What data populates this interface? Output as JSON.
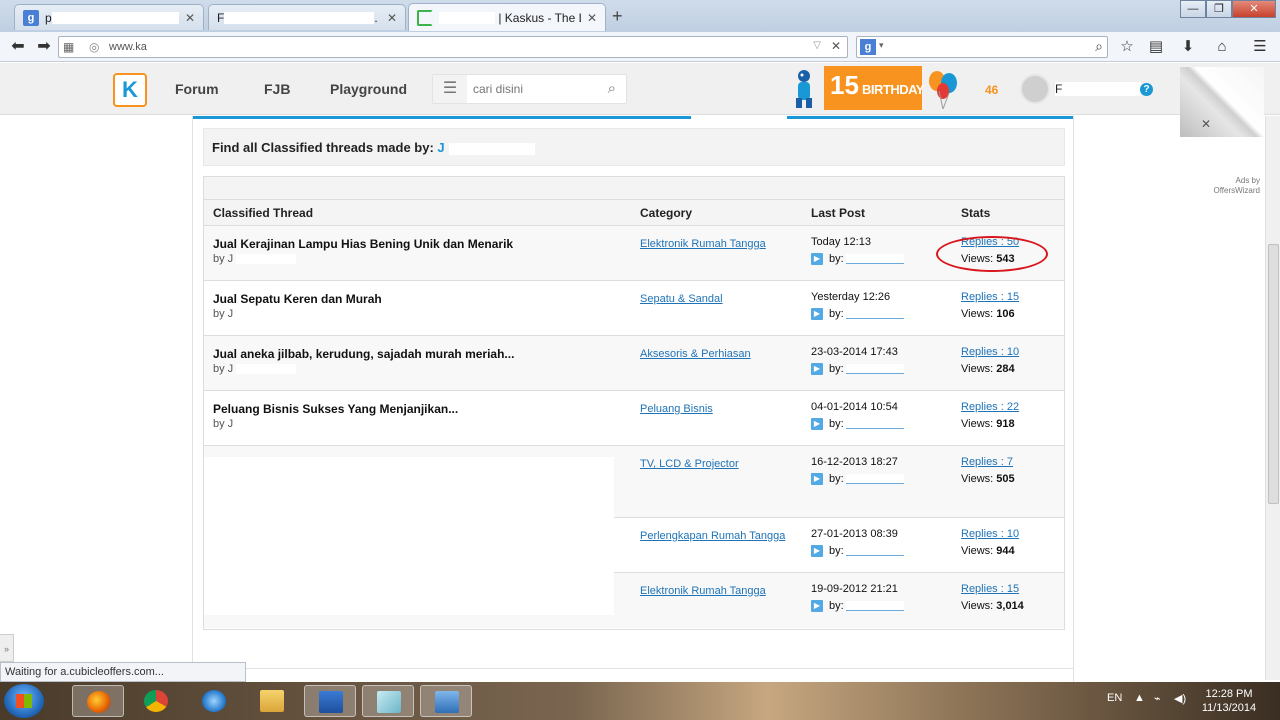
{
  "browser": {
    "tabs": [
      {
        "prefix": "p",
        "suffix": ".",
        "active": false
      },
      {
        "prefix": "F",
        "suffix": ".",
        "active": false
      },
      {
        "prefix": "",
        "suffix": "| Kaskus - The Lar...",
        "active": true
      }
    ],
    "url": "www.ka",
    "window_controls": {
      "minimize": "—",
      "maximize": "❐",
      "close": "✕"
    }
  },
  "kaskus_header": {
    "logo": "K",
    "nav": [
      "Forum",
      "FJB",
      "Playground"
    ],
    "search_placeholder": "cari disini",
    "birthday_number": "15",
    "birthday_text": "BIRTHDAY",
    "notification_count": "46",
    "username": "F",
    "help": "?"
  },
  "ads_label": "Ads by\nOffersWizard",
  "page": {
    "find_title": "Find all Classified threads made by:",
    "find_name": "J",
    "columns": [
      "Classified Thread",
      "Category",
      "Last Post",
      "Stats"
    ],
    "rows": [
      {
        "title": "Jual Kerajinan Lampu Hias Bening Unik dan Menarik",
        "by": "by J",
        "category": "Elektronik Rumah Tangga",
        "last_post": "Today 12:13",
        "last_by": "by:",
        "replies": "Replies : 50",
        "views_label": "Views:",
        "views": "543"
      },
      {
        "title": "Jual Sepatu Keren dan Murah",
        "by": "by J",
        "category": "Sepatu & Sandal",
        "last_post": "Yesterday 12:26",
        "last_by": "by:",
        "replies": "Replies : 15",
        "views_label": "Views:",
        "views": "106"
      },
      {
        "title": "Jual aneka jilbab, kerudung, sajadah murah meriah...",
        "by": "by J",
        "category": "Aksesoris & Perhiasan",
        "last_post": "23-03-2014 17:43",
        "last_by": "by:",
        "replies": "Replies : 10",
        "views_label": "Views:",
        "views": "284"
      },
      {
        "title": "Peluang Bisnis Sukses Yang Menjanjikan...",
        "by": "by J",
        "category": "Peluang Bisnis",
        "last_post": "04-01-2014 10:54",
        "last_by": "by:",
        "replies": "Replies : 22",
        "views_label": "Views:",
        "views": "918"
      },
      {
        "title": "",
        "by": "",
        "category": "TV, LCD & Projector",
        "last_post": "16-12-2013 18:27",
        "last_by": "by:",
        "replies": "Replies : 7",
        "views_label": "Views:",
        "views": "505"
      },
      {
        "title": "",
        "by": "",
        "category": "Perlengkapan Rumah Tangga",
        "last_post": "27-01-2013 08:39",
        "last_by": "by:",
        "replies": "Replies : 10",
        "views_label": "Views:",
        "views": "944"
      },
      {
        "title": "",
        "by": "",
        "category": "Elektronik Rumah Tangga",
        "last_post": "19-09-2012 21:21",
        "last_by": "by:",
        "replies": "Replies : 15",
        "views_label": "Views:",
        "views": "3,014"
      }
    ]
  },
  "status_bar": "Waiting for a.cubicleoffers.com...",
  "taskbar": {
    "language": "EN",
    "time": "12:28 PM",
    "date": "11/13/2014"
  },
  "colors": {
    "kaskus_blue": "#1998d5",
    "kaskus_orange": "#f7931e",
    "link": "#1f73b7",
    "highlight": "#d9161c"
  }
}
